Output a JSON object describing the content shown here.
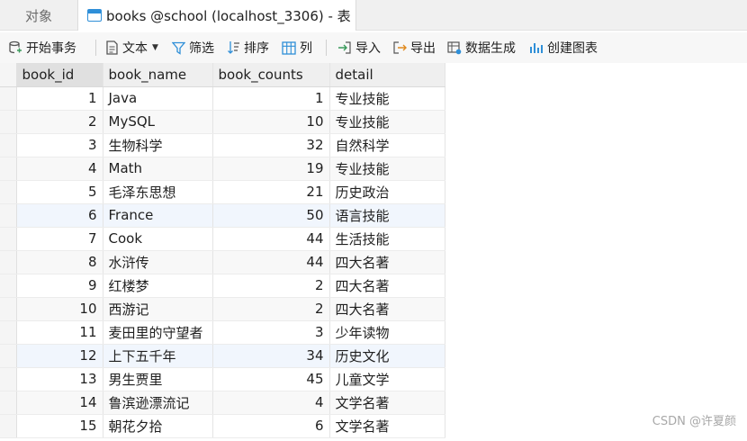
{
  "tabs": {
    "objects_label": "对象",
    "active_label": "books @school (localhost_3306) - 表"
  },
  "toolbar": {
    "begin_transaction": "开始事务",
    "text": "文本",
    "filter": "筛选",
    "sort": "排序",
    "columns": "列",
    "import": "导入",
    "export": "导出",
    "data_generation": "数据生成",
    "create_chart": "创建图表"
  },
  "table": {
    "columns": [
      "book_id",
      "book_name",
      "book_counts",
      "detail"
    ],
    "rows": [
      [
        "1",
        "Java",
        "1",
        "专业技能"
      ],
      [
        "2",
        "MySQL",
        "10",
        "专业技能"
      ],
      [
        "3",
        "生物科学",
        "32",
        "自然科学"
      ],
      [
        "4",
        "Math",
        "19",
        "专业技能"
      ],
      [
        "5",
        "毛泽东思想",
        "21",
        "历史政治"
      ],
      [
        "6",
        "France",
        "50",
        "语言技能"
      ],
      [
        "7",
        "Cook",
        "44",
        "生活技能"
      ],
      [
        "8",
        "水浒传",
        "44",
        "四大名著"
      ],
      [
        "9",
        "红楼梦",
        "2",
        "四大名著"
      ],
      [
        "10",
        "西游记",
        "2",
        "四大名著"
      ],
      [
        "11",
        "麦田里的守望者",
        "3",
        "少年读物"
      ],
      [
        "12",
        "上下五千年",
        "34",
        "历史文化"
      ],
      [
        "13",
        "男生贾里",
        "45",
        "儿童文学"
      ],
      [
        "14",
        "鲁滨逊漂流记",
        "4",
        "文学名著"
      ],
      [
        "15",
        "朝花夕拾",
        "6",
        "文学名著"
      ]
    ]
  },
  "watermark": "CSDN @许夏颜",
  "colors": {
    "accent": "#2f8fd8",
    "icon_green": "#3a9a5b",
    "header_bg": "#efefef"
  }
}
